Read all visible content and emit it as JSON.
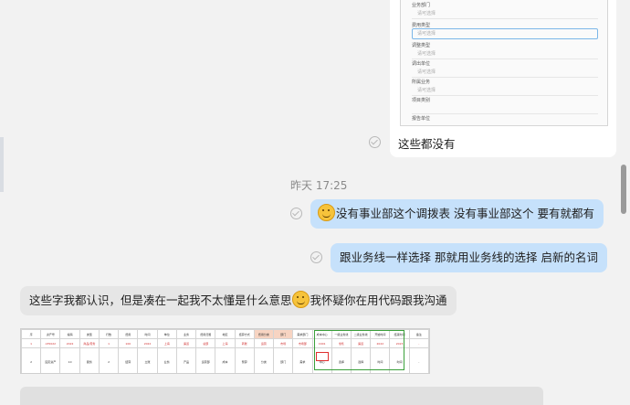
{
  "form_preview": {
    "rows": [
      {
        "label": "业务部门",
        "placeholder": "请可选择"
      },
      {
        "label": "费用类型",
        "placeholder": "请可选择"
      },
      {
        "label": "调整类型",
        "placeholder": "请可选择"
      },
      {
        "label": "调出单位",
        "placeholder": "请可选择"
      },
      {
        "label": "所属业务",
        "placeholder": "请可选择"
      },
      {
        "label": "项目类别",
        "placeholder": ""
      },
      {
        "label": "报告单位",
        "placeholder": ""
      }
    ]
  },
  "messages": {
    "msg1": "这些都没有",
    "timestamp": "昨天 17:25",
    "msg2": "没有事业部这个调拨表 没有事业部这个 要有就都有",
    "msg3": "跟业务线一样选择 那就用业务线的选择 启新的名词",
    "msg4_a": "这些字我都认识，但是凑在一起我不太懂是什么意思",
    "msg4_b": "我怀疑你在用代码跟我沟通"
  },
  "sheet": {
    "header": [
      "序",
      "资产号",
      "编码",
      "类型",
      "行数",
      "费用",
      "时间",
      "单位",
      "业务",
      "费用归属",
      "地区",
      "结算方式",
      "费用分类",
      "部门",
      "需求部门",
      "成本中心",
      "一级业务线",
      "二级业务线",
      "开始时间",
      "结束时间",
      "备注"
    ],
    "row1": [
      "1",
      "AF2022",
      "2022",
      "商品/劳务",
      "1",
      "100",
      "2022",
      "上海",
      "渠道",
      "总部",
      "上海",
      "转账",
      "运营",
      "市场",
      "市场部",
      "C001",
      "零售",
      "渠道",
      "2022",
      "2023",
      "-"
    ],
    "row2": [
      "2",
      "固定资产",
      "10",
      "服务",
      "2",
      "结算",
      "立账",
      "业务",
      "产品",
      "运营部",
      "成本",
      "预算",
      "分类",
      "部门",
      "需求",
      "中心",
      "选择",
      "选择",
      "时间",
      "时间",
      "-"
    ]
  },
  "colors": {
    "bubble_right": "#c6e1fb",
    "bubble_left": "#e6e6e6",
    "background": "#f2f2f2"
  }
}
